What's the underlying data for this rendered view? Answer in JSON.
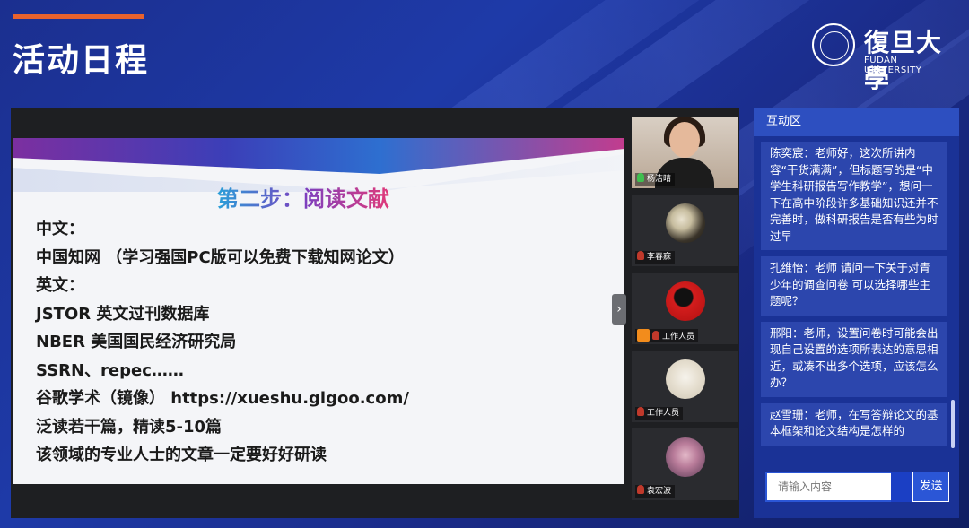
{
  "header": {
    "title": "活动日程",
    "logo_cn": "復旦大學",
    "logo_en": "FUDAN UNIVERSITY"
  },
  "slide": {
    "heading": "第二步：阅读文献",
    "lines": [
      "中文：",
      "中国知网 （学习强国PC版可以免费下载知网论文）",
      "英文：",
      "JSTOR 英文过刊数据库",
      "NBER 美国国民经济研究局",
      "SSRN、repec……",
      "谷歌学术（镜像） https://xueshu.glgoo.com/",
      "泛读若干篇，精读5-10篇",
      "该领域的专业人士的文章一定要好好研读"
    ]
  },
  "participants": [
    {
      "name": "杨洁晴",
      "mic": "on"
    },
    {
      "name": "李春寐",
      "mic": "off"
    },
    {
      "name": "工作人员",
      "mic": "off",
      "icon": "person-icon"
    },
    {
      "name": "工作人员",
      "mic": "off"
    },
    {
      "name": "袁宏波",
      "mic": "off"
    }
  ],
  "chat": {
    "title": "互动区",
    "messages": [
      "陈奕宸：老师好，这次所讲内容“干货满满”，但标题写的是“中学生科研报告写作教学”，想问一下在高中阶段许多基础知识还并不完善时，做科研报告是否有些为时过早",
      "孔维怡：老师 请问一下关于对青少年的调查问卷 可以选择哪些主题呢？",
      "邢阳：老师，设置问卷时可能会出现自己设置的选项所表达的意思相近，或凑不出多个选项，应该怎么办？",
      "赵雪珊：老师，在写答辩论文的基本框架和论文结构是怎样的"
    ],
    "input_placeholder": "请输入内容",
    "send_label": "发送"
  },
  "colors": {
    "accent": "#e8622d",
    "chat_panel": "#1a3296",
    "send_button": "#2b56d6"
  }
}
